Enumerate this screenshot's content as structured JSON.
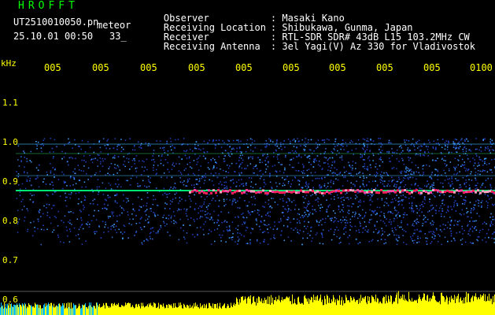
{
  "header": {
    "app_title": "HROFFT",
    "file_name": "UT2510010050.pn",
    "file_label": "meteor",
    "date": "25.10.01",
    "time": "00:50",
    "count": "33_"
  },
  "station": [
    {
      "label": "Observer",
      "value": ": Masaki Kano"
    },
    {
      "label": "Receiving Location",
      "value": ": Shibukawa, Gunma, Japan"
    },
    {
      "label": "Receiver",
      "value": ": RTL-SDR SDR# 43dB L15 103.2MHz CW"
    },
    {
      "label": "Receiving Antenna",
      "value": ": 3el Yagi(V) Az 330 for Vladivostok"
    }
  ],
  "axis": {
    "freq_unit": "kHz",
    "y_ticks": [
      "1.1",
      "1.0",
      "0.9",
      "0.8",
      "0.7",
      "0.6"
    ],
    "time_ticks": [
      "005",
      "005",
      "005",
      "005",
      "005",
      "005",
      "005",
      "005",
      "005",
      "0100"
    ]
  },
  "colors": {
    "background": "#000000",
    "text_primary": "#ffffff",
    "text_title": "#00ff00",
    "axis_labels": "#ffff00",
    "signal_strong": "#ff2060",
    "signal_medium": "#00ff80",
    "noise": "#3060ff"
  }
}
